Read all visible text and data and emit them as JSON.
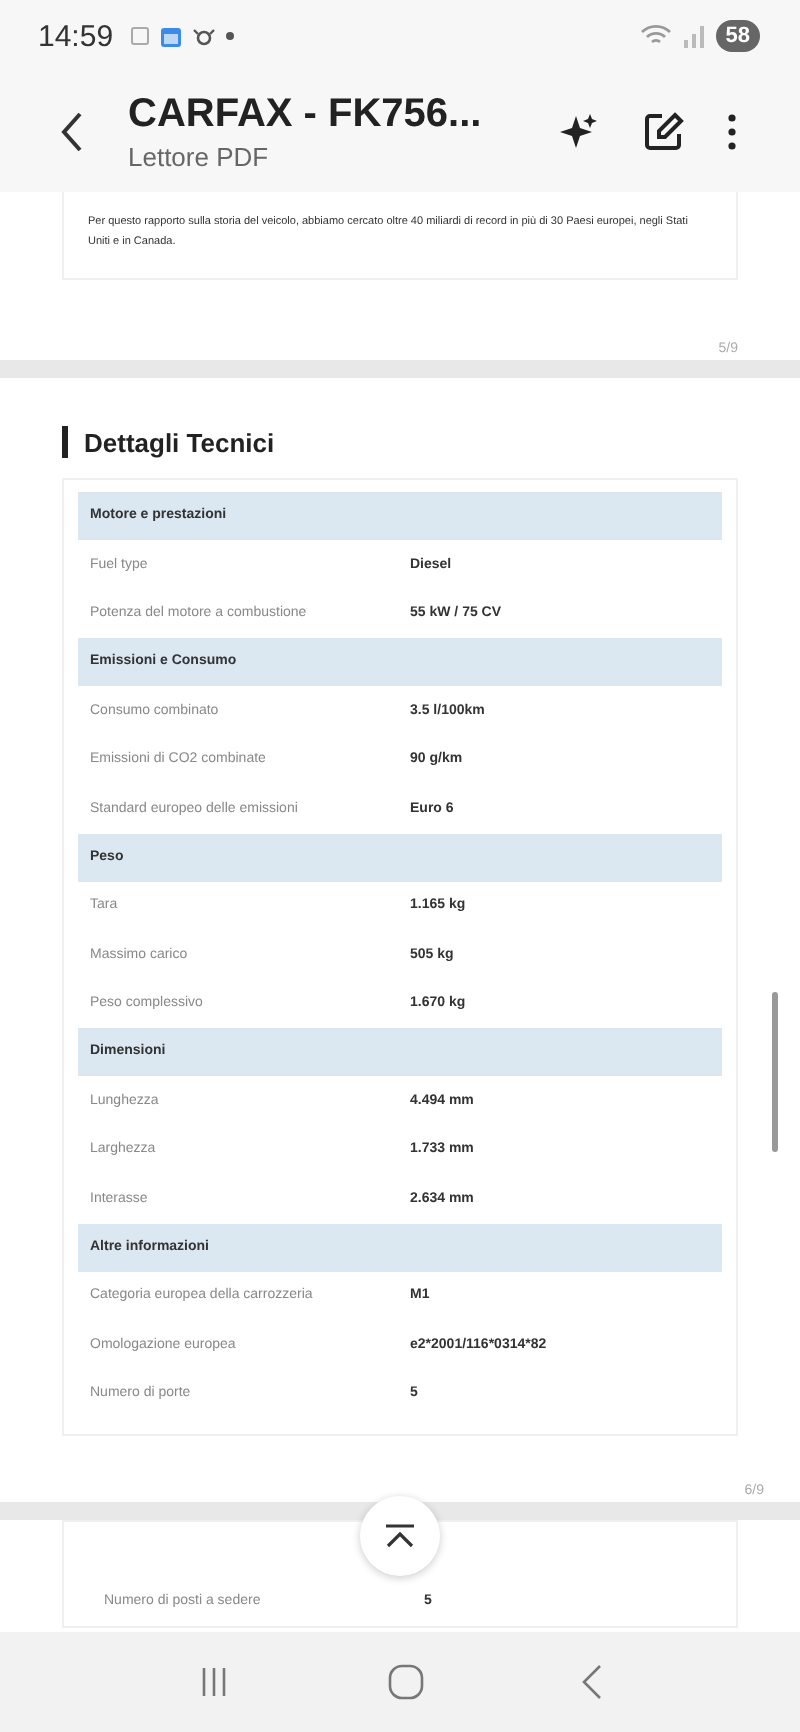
{
  "status_bar": {
    "time": "14:59",
    "battery": "58"
  },
  "app_bar": {
    "title": "CARFAX - FK756...",
    "subtitle": "Lettore PDF"
  },
  "pages": [
    {
      "kind": "text",
      "text": "Per questo rapporto sulla storia del veicolo, abbiamo cercato oltre 40 miliardi di record in più di 30 Paesi europei, negli Stati Uniti e in Canada.",
      "page_number": "5/9"
    },
    {
      "kind": "table",
      "heading": "Dettagli Tecnici",
      "page_number": "6/9",
      "sections": [
        {
          "title": "Motore e prestazioni",
          "rows": [
            {
              "label": "Fuel type",
              "value": "Diesel"
            },
            {
              "label": "Potenza del motore a combustione",
              "value": "55 kW / 75 CV"
            }
          ]
        },
        {
          "title": "Emissioni e Consumo",
          "rows": [
            {
              "label": "Consumo combinato",
              "value": "3.5 l/100km"
            },
            {
              "label": "Emissioni di CO2 combinate",
              "value": "90 g/km"
            },
            {
              "label": "Standard europeo delle emissioni",
              "value": "Euro 6"
            }
          ]
        },
        {
          "title": "Peso",
          "rows": [
            {
              "label": "Tara",
              "value": "1.165 kg"
            },
            {
              "label": "Massimo carico",
              "value": "505 kg"
            },
            {
              "label": "Peso complessivo",
              "value": "1.670 kg"
            }
          ]
        },
        {
          "title": "Dimensioni",
          "rows": [
            {
              "label": "Lunghezza",
              "value": "4.494 mm"
            },
            {
              "label": "Larghezza",
              "value": "1.733 mm"
            },
            {
              "label": "Interasse",
              "value": "2.634 mm"
            }
          ]
        },
        {
          "title": "Altre informazioni",
          "rows": [
            {
              "label": "Categoria europea della carrozzeria",
              "value": "M1"
            },
            {
              "label": "Omologazione europea",
              "value": "e2*2001/116*0314*82"
            },
            {
              "label": "Numero di porte",
              "value": "5"
            }
          ]
        }
      ]
    },
    {
      "kind": "rows",
      "rows": [
        {
          "label": "Numero di posti a sedere",
          "value": "5"
        }
      ]
    }
  ]
}
